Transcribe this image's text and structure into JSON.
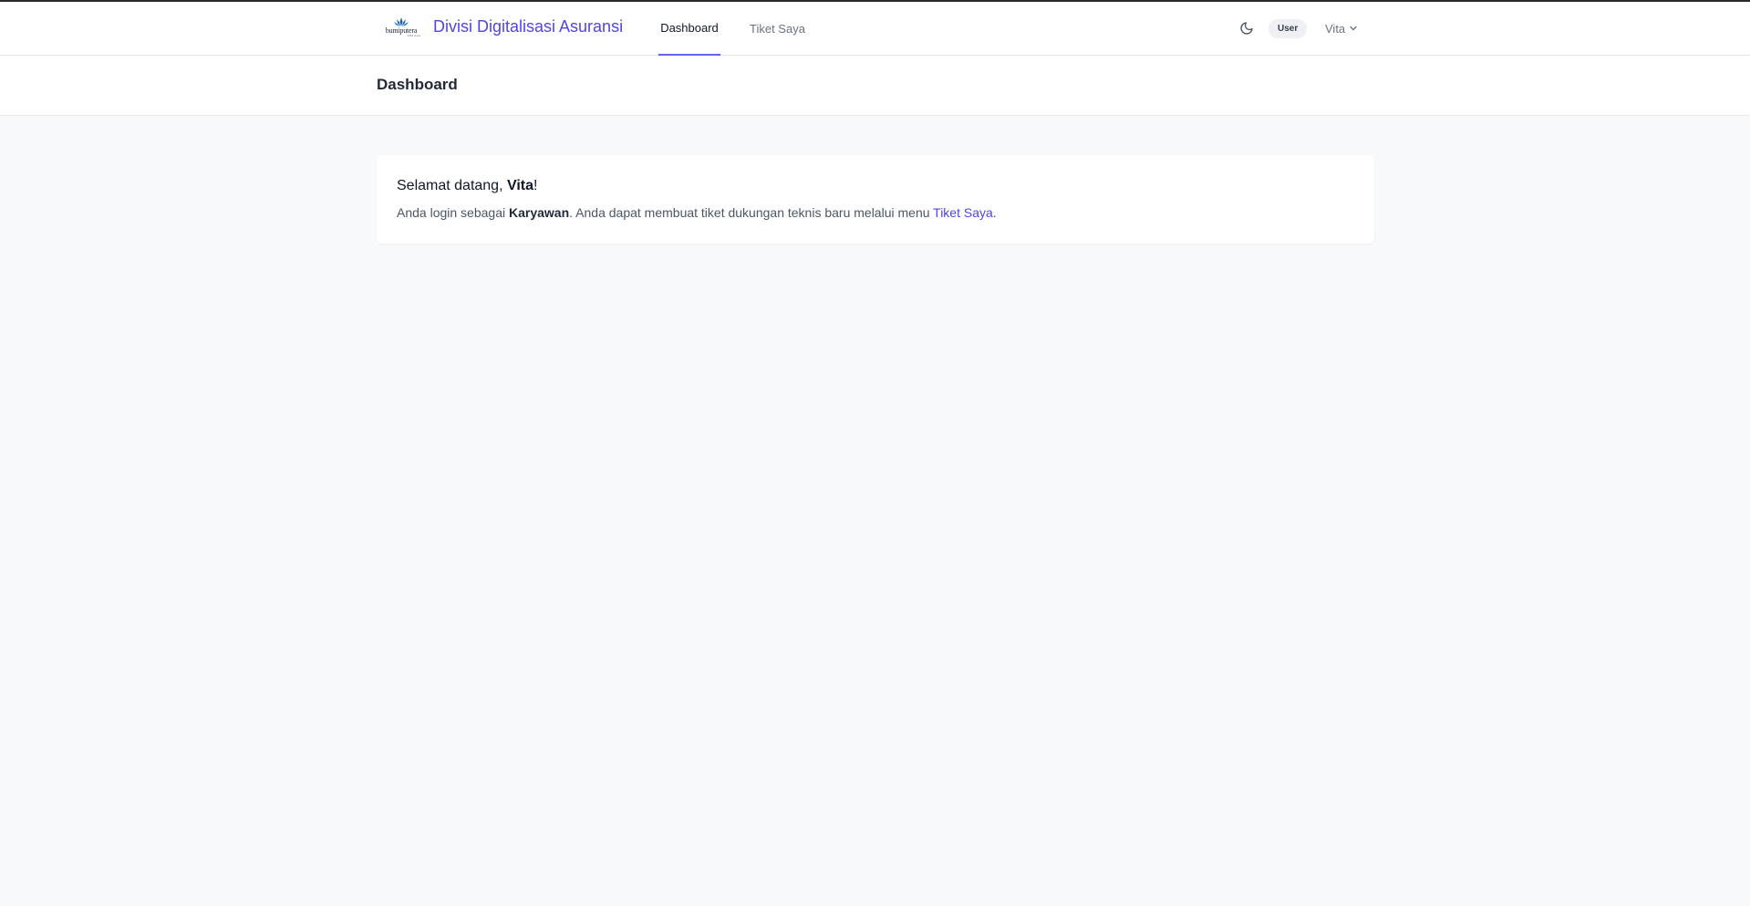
{
  "navbar": {
    "logo_text": "bumiputera",
    "logo_subtext": "1912 since",
    "app_title": "Divisi Digitalisasi Asuransi",
    "links": [
      {
        "label": "Dashboard",
        "active": true
      },
      {
        "label": "Tiket Saya",
        "active": false
      }
    ],
    "theme_toggle_icon": "moon-icon",
    "role_badge": "User",
    "user_name": "Vita",
    "user_menu_icon": "chevron-down-icon"
  },
  "header": {
    "title": "Dashboard"
  },
  "welcome_card": {
    "greeting_prefix": "Selamat datang, ",
    "greeting_name": "Vita",
    "greeting_suffix": "!",
    "desc_prefix": "Anda login sebagai ",
    "desc_role": "Karyawan",
    "desc_middle": ". Anda dapat membuat tiket dukungan teknis baru melalui menu ",
    "desc_link": "Tiket Saya",
    "desc_suffix": "."
  },
  "colors": {
    "accent": "#4f46e5",
    "active_underline": "#6366f1",
    "background": "#f8f9fb",
    "logo_blue": "#1e5fa8"
  }
}
